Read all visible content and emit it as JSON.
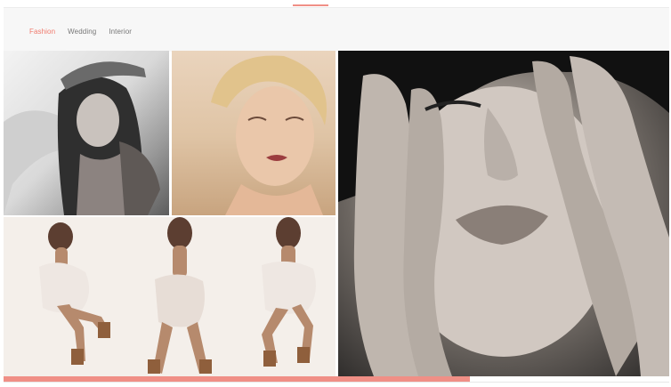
{
  "theme": {
    "accent_color": "#f08f86",
    "tab_active_color": "#f07a6d",
    "tab_inactive_color": "#777777"
  },
  "filters": {
    "tabs": [
      {
        "label": "Fashion",
        "active": true
      },
      {
        "label": "Wedding",
        "active": false
      },
      {
        "label": "Interior",
        "active": false
      }
    ]
  },
  "gallery": {
    "items": [
      {
        "icon": "portrait-photo",
        "alt": "Fashion portrait"
      },
      {
        "icon": "portrait-photo",
        "alt": "Blonde portrait"
      },
      {
        "icon": "dancers-photo",
        "alt": "Three dancers"
      },
      {
        "icon": "close-up-photo",
        "alt": "Face close-up with hands"
      }
    ]
  },
  "progress": {
    "value": 0.7
  }
}
